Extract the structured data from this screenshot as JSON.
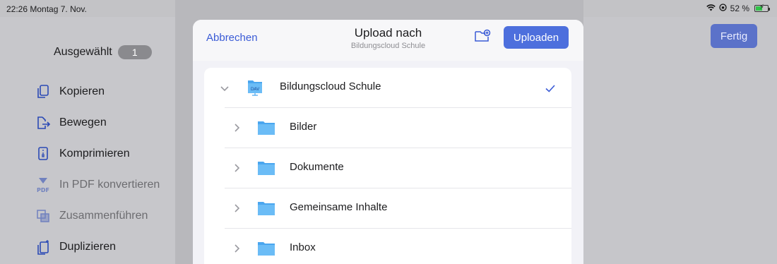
{
  "status": {
    "time_date": "22:26  Montag 7. Nov.",
    "dots": "•••",
    "battery_text": "52 %"
  },
  "sidebar": {
    "selected_label": "Ausgewählt",
    "selected_count": "1",
    "items": [
      {
        "label": "Kopieren",
        "icon": "copy-icon",
        "enabled": true
      },
      {
        "label": "Bewegen",
        "icon": "move-icon",
        "enabled": true
      },
      {
        "label": "Komprimieren",
        "icon": "compress-icon",
        "enabled": true
      },
      {
        "label": "In PDF konvertieren",
        "icon": "pdf-convert-icon",
        "icon_text": "PDF",
        "enabled": false
      },
      {
        "label": "Zusammenführen",
        "icon": "merge-icon",
        "enabled": false
      },
      {
        "label": "Duplizieren",
        "icon": "duplicate-icon",
        "enabled": true
      }
    ]
  },
  "right": {
    "done_label": "Fertig"
  },
  "dialog": {
    "cancel_label": "Abbrechen",
    "title": "Upload nach",
    "subtitle": "Bildungscloud Schule",
    "upload_label": "Uploaden",
    "root": {
      "label": "Bildungscloud Schule",
      "icon_text": "DAV",
      "expanded": true,
      "selected": true
    },
    "folders": [
      {
        "label": "Bilder"
      },
      {
        "label": "Dokumente"
      },
      {
        "label": "Gemeinsame Inhalte"
      },
      {
        "label": "Inbox"
      }
    ]
  },
  "colors": {
    "accent": "#4d6fdd",
    "link": "#3a5bd6",
    "folder": "#5ab8f4",
    "dimmed_background": "#c3c3c6"
  }
}
